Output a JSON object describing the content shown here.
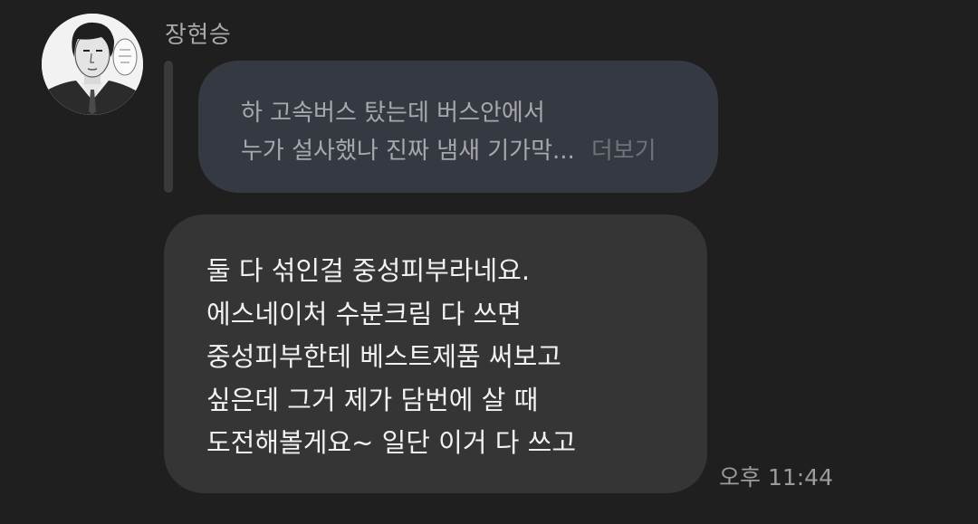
{
  "sender": {
    "name": "장현승",
    "avatar_icon": "profile-illustration"
  },
  "quoted_message": {
    "lines": [
      "하 고속버스 탔는데 버스안에서",
      "누가 설사했나 진짜 냄새 기가막..."
    ],
    "more_label": "더보기"
  },
  "message": {
    "lines": [
      "둘 다 섞인걸 중성피부라네요.",
      "에스네이처 수분크림 다 쓰면",
      "중성피부한테 베스트제품 써보고",
      "싶은데 그거 제가 담번에 살 때",
      "도전해볼게요~ 일단 이거 다 쓰고"
    ],
    "time": "오후 11:44"
  },
  "colors": {
    "background": "#1f1f1f",
    "quote_bubble": "#353941",
    "message_bubble": "#353535",
    "text_primary": "#f2f2f2",
    "text_secondary": "#a7a8ad"
  }
}
